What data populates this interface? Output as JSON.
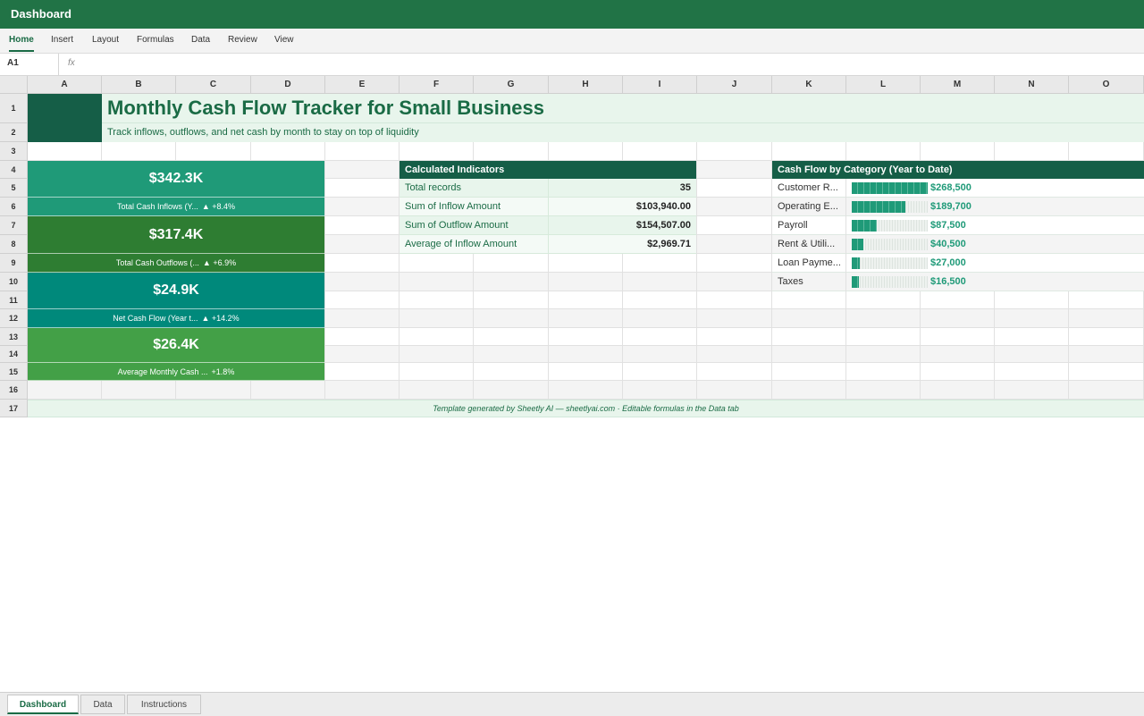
{
  "app": {
    "title": "Dashboard"
  },
  "ribbon": {
    "tabs": [
      {
        "label": "Home",
        "active": true
      },
      {
        "label": "Insert"
      },
      {
        "label": "Layout"
      },
      {
        "label": "Formulas"
      },
      {
        "label": "Data"
      },
      {
        "label": "Review"
      },
      {
        "label": "View"
      }
    ]
  },
  "formula_bar": {
    "cell_ref": "A1",
    "fx": "fx",
    "value": ""
  },
  "columns": [
    "A",
    "B",
    "C",
    "D",
    "E",
    "F",
    "G",
    "H",
    "I",
    "J",
    "K",
    "L",
    "M",
    "N",
    "O"
  ],
  "rows": [
    "1",
    "2",
    "3",
    "4",
    "5",
    "6",
    "7",
    "8",
    "9",
    "10",
    "11",
    "12",
    "13",
    "14",
    "15",
    "16",
    "17"
  ],
  "header": {
    "title": "Monthly Cash Flow Tracker for Small Business",
    "subtitle": "Track inflows, outflows, and net cash by month to stay on top of liquidity"
  },
  "kpis": [
    {
      "value": "$342.3K",
      "label": "Total Cash Inflows (Y...",
      "change": "▲ +8.4%",
      "color": "#1f9a78"
    },
    {
      "value": "$317.4K",
      "label": "Total Cash Outflows (...",
      "change": "▲ +6.9%",
      "color": "#2e7d32"
    },
    {
      "value": "$24.9K",
      "label": "Net Cash Flow (Year t...",
      "change": "▲ +14.2%",
      "color": "#00897b"
    },
    {
      "value": "$26.4K",
      "label": "Average Monthly Cash ...",
      "change": "+1.8%",
      "color": "#43a047"
    }
  ],
  "indicators": {
    "title": "Calculated Indicators",
    "rows": [
      {
        "label": "Total records",
        "value": "35"
      },
      {
        "label": "Sum of Inflow Amount",
        "value": "$103,940.00"
      },
      {
        "label": "Sum of Outflow Amount",
        "value": "$154,507.00"
      },
      {
        "label": "Average of Inflow Amount",
        "value": "$2,969.71"
      }
    ]
  },
  "categories": {
    "title": "Cash Flow by Category (Year to Date)",
    "rows": [
      {
        "label": "Customer R...",
        "value": "$268,500",
        "amount": 268500
      },
      {
        "label": "Operating E...",
        "value": "$189,700",
        "amount": 189700
      },
      {
        "label": "Payroll",
        "value": "$87,500",
        "amount": 87500
      },
      {
        "label": "Rent & Utili...",
        "value": "$40,500",
        "amount": 40500
      },
      {
        "label": "Loan Payme...",
        "value": "$27,000",
        "amount": 27000
      },
      {
        "label": "Taxes",
        "value": "$16,500",
        "amount": 16500
      }
    ]
  },
  "footer": {
    "note": "Template generated by Sheetly AI — sheetlyai.com · Editable formulas in the Data tab"
  },
  "sheets": [
    {
      "label": "Dashboard",
      "active": true
    },
    {
      "label": "Data"
    },
    {
      "label": "Instructions"
    }
  ],
  "theme": {
    "accent": "#217346",
    "dark": "#155e47",
    "light": "#e8f5ec"
  }
}
